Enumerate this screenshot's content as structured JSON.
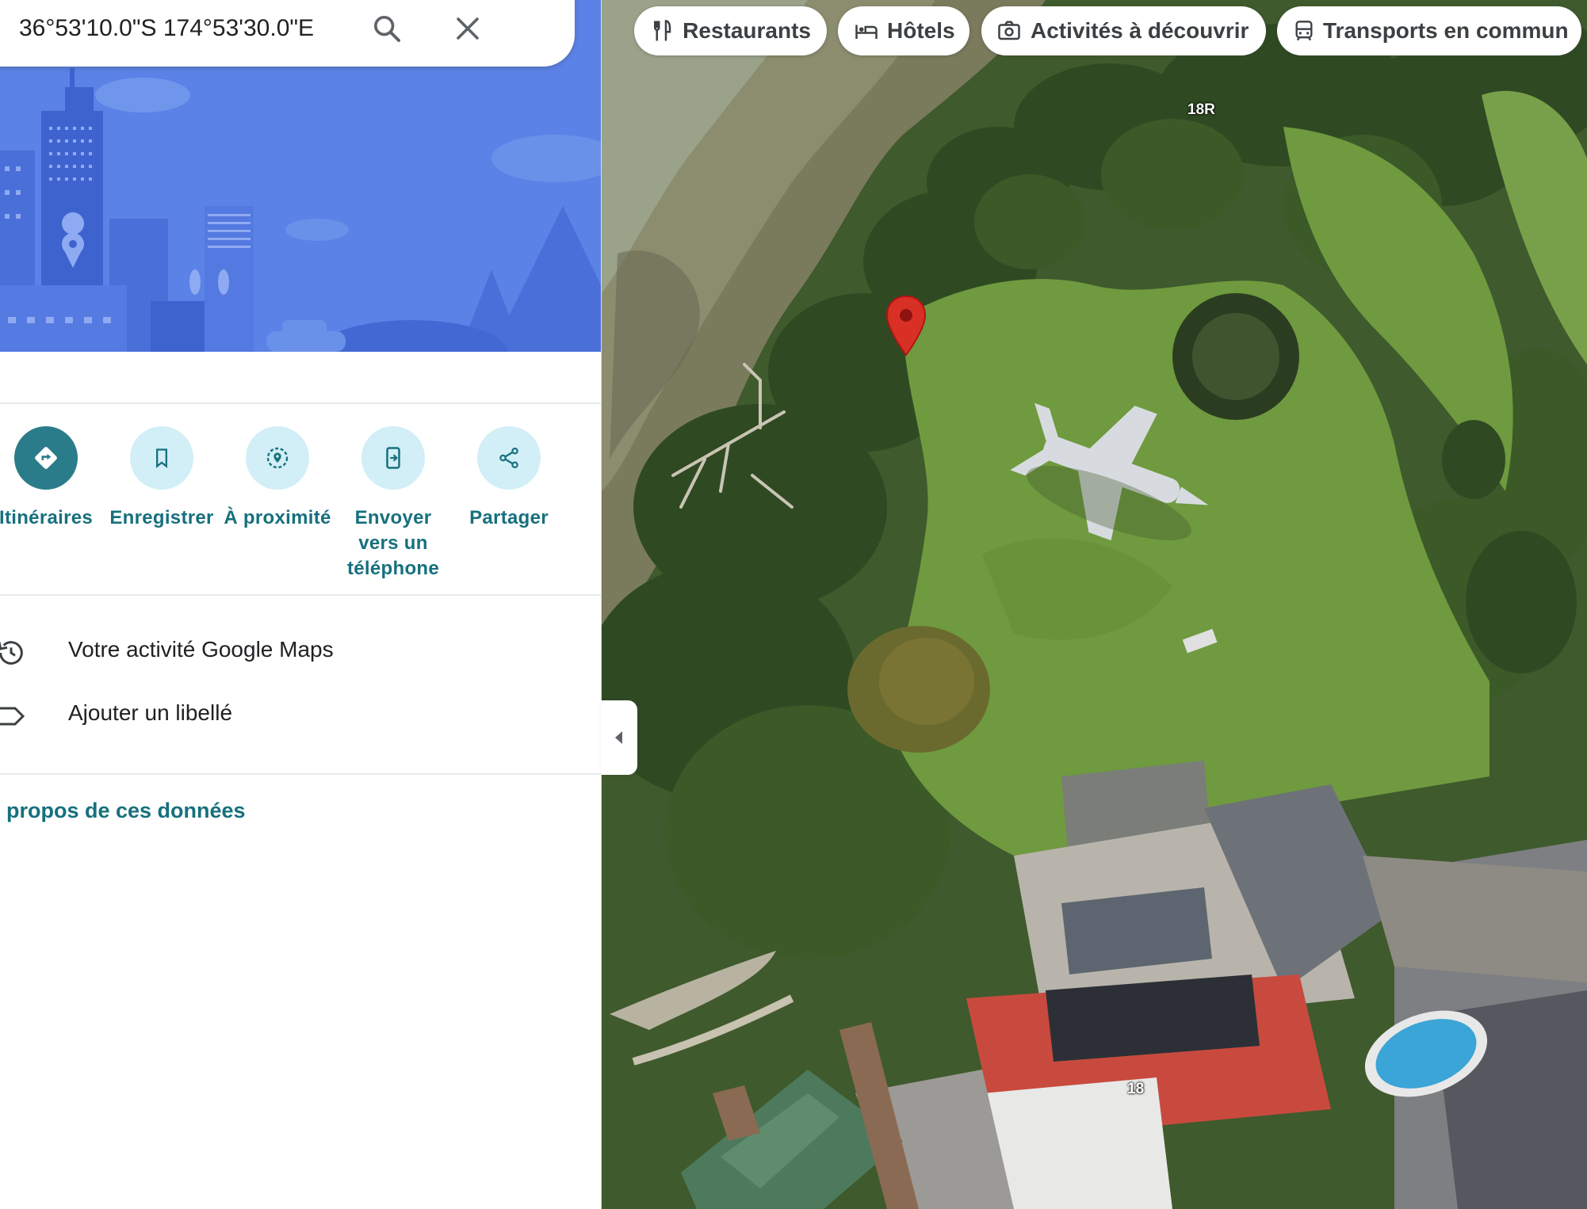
{
  "search": {
    "value": "36°53'10.0\"S 174°53'30.0\"E",
    "search_icon": "search-icon",
    "close_icon": "close-icon"
  },
  "actions": [
    {
      "label": "Itinéraires",
      "icon": "directions-icon"
    },
    {
      "label": "Enregistrer",
      "icon": "bookmark-icon"
    },
    {
      "label": "À proximité",
      "icon": "nearby-icon"
    },
    {
      "label": "Envoyer vers un téléphone",
      "icon": "send-to-phone-icon"
    },
    {
      "label": "Partager",
      "icon": "share-icon"
    }
  ],
  "list": [
    {
      "label": "Votre activité Google Maps",
      "icon": "history-icon"
    },
    {
      "label": "Ajouter un libellé",
      "icon": "label-icon"
    }
  ],
  "about_link": "propos de ces données",
  "chips": [
    {
      "label": "Restaurants",
      "icon": "restaurant-icon"
    },
    {
      "label": "Hôtels",
      "icon": "hotel-icon"
    },
    {
      "label": "Activités à découvrir",
      "icon": "camera-icon"
    },
    {
      "label": "Transports en commun",
      "icon": "transit-icon"
    }
  ],
  "map_labels": {
    "top": "18R",
    "bottom": "18"
  },
  "colors": {
    "accent": "#17707d",
    "primary_action": "#2a7c8a",
    "action_bg": "#d2eef6",
    "pin": "#d93025",
    "hero": "#5b82e6"
  }
}
